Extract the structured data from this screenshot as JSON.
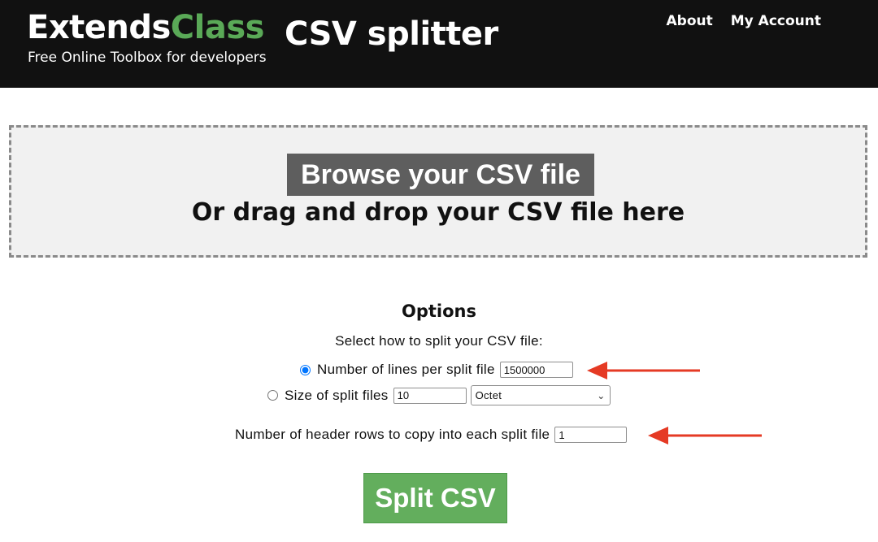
{
  "header": {
    "brand_primary": "Extends",
    "brand_accent": "Class",
    "tagline": "Free Online Toolbox for developers",
    "page_title": "CSV splitter",
    "nav": [
      "About",
      "My Account"
    ]
  },
  "dropzone": {
    "browse_label": "Browse your CSV file",
    "drop_text": "Or drag and drop your CSV file here"
  },
  "options": {
    "title": "Options",
    "subtitle": "Select how to split your CSV file:",
    "lines_label": "Number of lines per split file",
    "lines_value": "1500000",
    "lines_selected": true,
    "size_label": "Size of split files",
    "size_value": "10",
    "size_unit": "Octet",
    "size_selected": false,
    "header_rows_label": "Number of header rows to copy into each split file",
    "header_rows_value": "1"
  },
  "split_button_label": "Split CSV",
  "colors": {
    "header_bg": "#111111",
    "brand_accent": "#5aa957",
    "split_button": "#63ae5d",
    "browse_button": "#5e5e5e",
    "annotation_arrow": "#e53a24"
  }
}
